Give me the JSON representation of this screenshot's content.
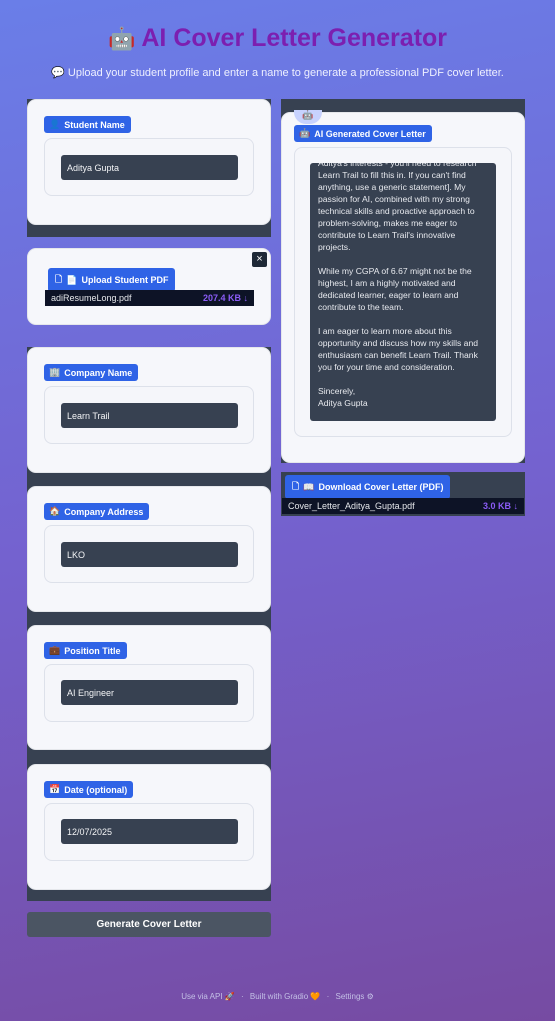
{
  "header": {
    "title_icon": "robot-icon",
    "title": "AI Cover Letter Generator",
    "subtitle_icon": "speech-bubble-icon",
    "subtitle": "Upload your student profile and enter a name to generate a professional PDF cover letter."
  },
  "student": {
    "label": "Student Name",
    "value": "Aditya Gupta"
  },
  "upload": {
    "label": "Upload Student PDF",
    "file_name": "adiResumeLong.pdf",
    "file_size": "207.4 KB ↓",
    "close": "×"
  },
  "company_name": {
    "label": "Company Name",
    "value": "Learn Trail"
  },
  "company_address": {
    "label": "Company Address",
    "value": "LKO"
  },
  "position": {
    "label": "Position Title",
    "value": "AI Engineer"
  },
  "date": {
    "label": "Date (optional)",
    "value": "12/07/2025"
  },
  "generate_button": "Generate Cover Letter",
  "output": {
    "label": "AI Generated Cover Letter",
    "letter_paragraphs": [
      "Aditya's interests - you'll need to research Learn Trail to fill this in. If you can't find anything, use a generic statement]. My passion for AI, combined with my strong technical skills and proactive approach to problem-solving, makes me eager to contribute to Learn Trail's innovative projects.",
      "While my CGPA of 6.67 might not be the highest, I am a highly motivated and dedicated learner, eager to learn and contribute to the team.",
      "I am eager to learn more about this opportunity and discuss how my skills and enthusiasm can benefit Learn Trail. Thank you for your time and consideration.",
      "Sincerely,\nAditya Gupta"
    ]
  },
  "download": {
    "label": "Download Cover Letter (PDF)",
    "file_name": "Cover_Letter_Aditya_Gupta.pdf",
    "file_size": "3.0 KB ↓"
  },
  "footer": {
    "api": "Use via API",
    "built": "Built with Gradio",
    "settings": "Settings",
    "sep": "·"
  }
}
